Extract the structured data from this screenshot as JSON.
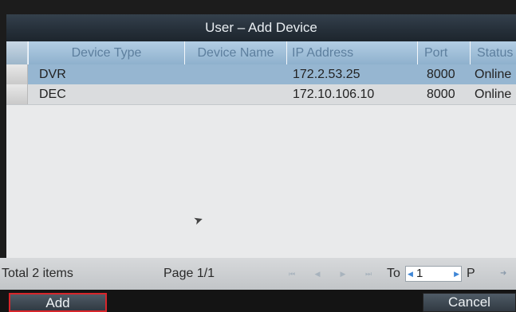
{
  "window": {
    "title": "User – Add Device"
  },
  "table": {
    "columns": [
      "Device Type",
      "Device Name",
      "IP Address",
      "Port",
      "Status"
    ],
    "rows": [
      {
        "type": "DVR",
        "name": "",
        "ip": "172.2.53.25",
        "port": "8000",
        "status": "Online"
      },
      {
        "type": "DEC",
        "name": "",
        "ip": "172.10.106.10",
        "port": "8000",
        "status": "Online"
      }
    ]
  },
  "pagination": {
    "total": "Total 2 items",
    "page": "Page 1/1",
    "to_label": "To",
    "page_value": "1",
    "unit": "P"
  },
  "buttons": {
    "add": "Add",
    "cancel": "Cancel"
  },
  "colors": {
    "selected_row": "#96b6d1",
    "header": "#a3c2dc",
    "highlight_border": "#d8262b"
  }
}
